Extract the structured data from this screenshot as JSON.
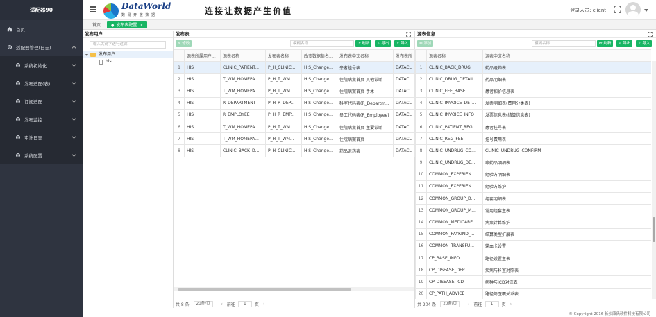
{
  "sidebar": {
    "title": "适配器90",
    "items": [
      {
        "label": "首页",
        "icon": "home-icon",
        "sub": false
      },
      {
        "label": "适配器管理(日志)",
        "icon": "gear-icon",
        "sub": false,
        "open": true
      },
      {
        "label": "系统初始化",
        "icon": "gear-icon",
        "sub": true
      },
      {
        "label": "发布适配(表)",
        "icon": "gear-icon",
        "sub": true
      },
      {
        "label": "订阅适配",
        "icon": "gear-icon",
        "sub": true
      },
      {
        "label": "发布监控",
        "icon": "gear-icon",
        "sub": true
      },
      {
        "label": "审计日志",
        "icon": "gear-icon",
        "sub": true
      },
      {
        "label": "系统配置",
        "icon": "gear-icon",
        "sub": true
      }
    ]
  },
  "header": {
    "logo_text": "DataWorld",
    "logo_sub": "数 易 开 放 数 据",
    "slogan": "连接让数据产生价值",
    "login_label": "登录人员: client"
  },
  "tabs": [
    {
      "label": "首页",
      "active": false
    },
    {
      "label": "发布表配置",
      "active": true,
      "close": "×"
    }
  ],
  "left_panel": {
    "title": "发布用户",
    "search_placeholder": "输入关键字进行过滤",
    "root": "发布用户",
    "child": "his"
  },
  "mid_panel": {
    "title": "发布表",
    "modify_btn": "修改",
    "search_placeholder": "模糊名称",
    "refresh_btn": "刷新",
    "export_btn": "导出",
    "import_btn": "导入",
    "columns": [
      "",
      "源表所属用户...",
      "源表名称",
      "发布表名称",
      "改变数据集名...",
      "发布表中文名称",
      "发布表所"
    ],
    "rows": [
      [
        "1",
        "HIS",
        "CLINIC_PATIENT...",
        "P_H_CLINIC...",
        "HIS_Change...",
        "患者挂号表",
        "DATACL"
      ],
      [
        "2",
        "HIS",
        "T_WM_HOMEPA...",
        "P_H_T_WM...",
        "HIS_Change...",
        "住院病案首页-其他诊断",
        "DATACL"
      ],
      [
        "3",
        "HIS",
        "T_WM_HOMEPA...",
        "P_H_T_WM...",
        "HIS_Change...",
        "住院病案首页-手术",
        "DATACL"
      ],
      [
        "4",
        "HIS",
        "R_DEPARTMENT",
        "P_H_R_DEP...",
        "HIS_Change...",
        "科室代码表(R_Departm...",
        "DATACL"
      ],
      [
        "5",
        "HIS",
        "R_EMPLOYEE",
        "P_H_R_EMP...",
        "HIS_Change...",
        "员工代码表(R_Employee)",
        "DATACL"
      ],
      [
        "6",
        "HIS",
        "T_WM_HOMEPA...",
        "P_H_T_WM...",
        "HIS_Change...",
        "住院病案首页-主要诊断",
        "DATACL"
      ],
      [
        "7",
        "HIS",
        "T_WM_HOMEPA...",
        "P_H_T_WM...",
        "HIS_Change...",
        "住院病案首页",
        "DATACL"
      ],
      [
        "8",
        "HIS",
        "CLINIC_BACK_D...",
        "P_H_CLINIC...",
        "HIS_Change...",
        "药品退药表",
        "DATACL"
      ]
    ],
    "total": "共 8 条",
    "page_size": "20条/页",
    "goto_label": "前往",
    "page": "1",
    "page_unit": "页"
  },
  "right_panel": {
    "title": "源表信息",
    "add_btn": "添加",
    "search_placeholder": "模糊名称",
    "refresh_btn": "刷新",
    "export_btn": "导出",
    "import_btn": "导入",
    "columns": [
      "",
      "源表名称",
      "源表中文名称"
    ],
    "rows": [
      [
        "1",
        "CLINIC_BACK_DRUG",
        "药品退药表"
      ],
      [
        "2",
        "CLINIC_DRUG_DETAIL",
        "药品明细表"
      ],
      [
        "3",
        "CLINIC_FEE_BASE",
        "患者扣价信息表"
      ],
      [
        "4",
        "CLINIC_INVOICE_DET...",
        "发票明细表(费用分类表)"
      ],
      [
        "5",
        "CLINIC_INVOICE_INFO",
        "发票信息表(结算信息表)"
      ],
      [
        "6",
        "CLINIC_PATIENT_REG",
        "患者挂号表"
      ],
      [
        "7",
        "CLINIC_REG_FEE",
        "挂号费用表"
      ],
      [
        "8",
        "CLINIC_UNDRUG_CO...",
        "CLINIC_UNDRUG_CONFIRM"
      ],
      [
        "9",
        "CLINIC_UNDRUG_DE...",
        "非药品明细表"
      ],
      [
        "10",
        "COMMON_EXPERIEN...",
        "经验方明细表"
      ],
      [
        "11",
        "COMMON_EXPERIEN...",
        "经验方维护"
      ],
      [
        "12",
        "COMMON_GROUP_D...",
        "组套明细表"
      ],
      [
        "13",
        "COMMON_GROUP_M...",
        "常用组套主表"
      ],
      [
        "14",
        "COMMON_MEDICARE...",
        "病案计算维护"
      ],
      [
        "15",
        "COMMON_PAYKIND_...",
        "结算类型扩展表"
      ],
      [
        "16",
        "COMMON_TRANSFU...",
        "输血卡设置"
      ],
      [
        "17",
        "CP_BASE_INFO",
        "路径设置主表"
      ],
      [
        "18",
        "CP_DISEASE_DEPT",
        "疾病与科室对照表"
      ],
      [
        "19",
        "CP_DISEASE_ICD",
        "病种与ICD对应表"
      ],
      [
        "20",
        "CP_PATH_ADVICE",
        "路径与医嘱关系表"
      ]
    ],
    "total": "共 204 条",
    "page_size": "20条/页",
    "goto_label": "前往",
    "page": "1",
    "page_unit": "页"
  },
  "copyright": "© Copyright 2016 长沙康氏软件科技有限公司"
}
